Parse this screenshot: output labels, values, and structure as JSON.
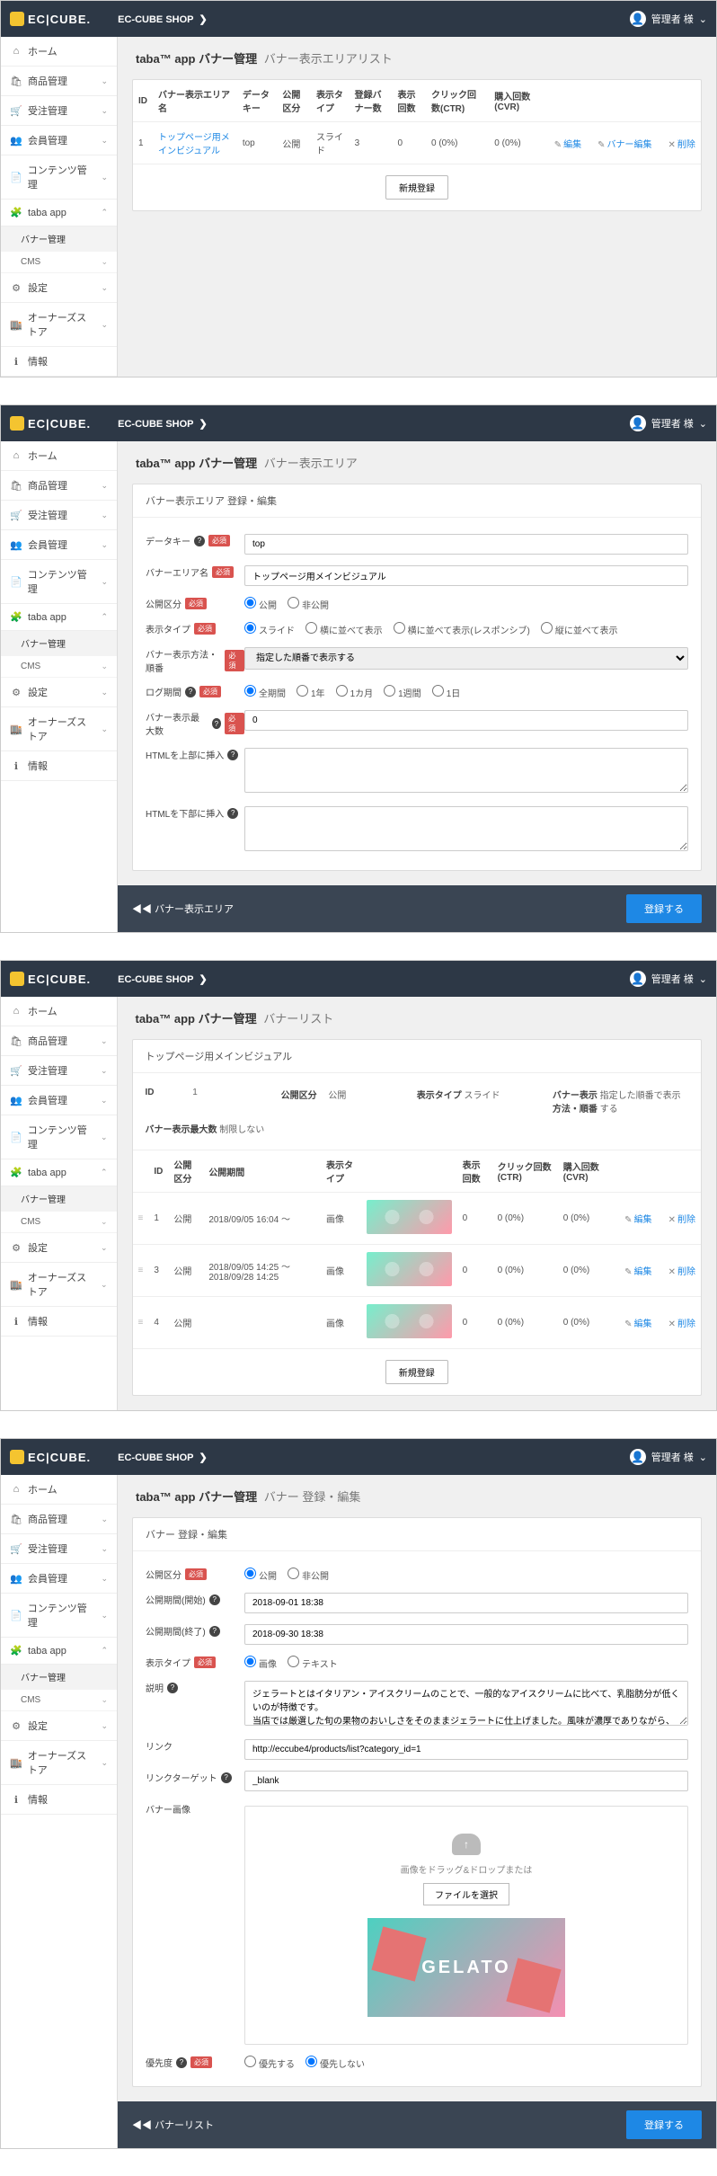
{
  "common": {
    "logo": "EC|CUBE.",
    "shop": "EC-CUBE SHOP",
    "user": "管理者 様",
    "chev": "❯",
    "down": "⌄"
  },
  "side": {
    "items": [
      {
        "ic": "⌂",
        "l": "ホーム",
        "e": ""
      },
      {
        "ic": "🛍",
        "l": "商品管理",
        "e": "⌄"
      },
      {
        "ic": "🛒",
        "l": "受注管理",
        "e": "⌄"
      },
      {
        "ic": "👥",
        "l": "会員管理",
        "e": "⌄"
      },
      {
        "ic": "📄",
        "l": "コンテンツ管理",
        "e": "⌄"
      },
      {
        "ic": "🧩",
        "l": "taba app",
        "e": "⌃"
      }
    ],
    "subs": [
      {
        "l": "バナー管理",
        "a": true
      },
      {
        "l": "CMS",
        "e": "⌄"
      }
    ],
    "items2": [
      {
        "ic": "⚙",
        "l": "設定",
        "e": "⌄"
      },
      {
        "ic": "🏬",
        "l": "オーナーズストア",
        "e": "⌄"
      },
      {
        "ic": "ℹ",
        "l": "情報",
        "e": ""
      }
    ]
  },
  "s1": {
    "title": "taba™ app バナー管理",
    "sub": "バナー表示エリアリスト",
    "th": [
      "ID",
      "バナー表示エリア名",
      "データキー",
      "公開区分",
      "表示タイプ",
      "登録バナー数",
      "表示回数",
      "クリック回数(CTR)",
      "購入回数(CVR)",
      "",
      "",
      ""
    ],
    "row": {
      "id": "1",
      "name": "トップページ用メインビジュアル",
      "key": "top",
      "pub": "公開",
      "type": "スライド",
      "cnt": "3",
      "imp": "0",
      "ctr": "0 (0%)",
      "cvr": "0 (0%)",
      "e": "編集",
      "b": "バナー編集",
      "d": "削除"
    },
    "new": "新規登録"
  },
  "s2": {
    "title": "taba™ app バナー管理",
    "sub": "バナー表示エリア",
    "hd": "バナー表示エリア 登録・編集",
    "f": {
      "key": {
        "l": "データキー",
        "v": "top"
      },
      "name": {
        "l": "バナーエリア名",
        "v": "トップページ用メインビジュアル"
      },
      "pub": {
        "l": "公開区分",
        "o": [
          "公開",
          "非公開"
        ]
      },
      "dtype": {
        "l": "表示タイプ",
        "o": [
          "スライド",
          "横に並べて表示",
          "横に並べて表示(レスポンシブ)",
          "縦に並べて表示"
        ]
      },
      "order": {
        "l": "バナー表示方法・順番",
        "v": "指定した順番で表示する"
      },
      "log": {
        "l": "ログ期間",
        "o": [
          "全期間",
          "1年",
          "1カ月",
          "1週間",
          "1日"
        ]
      },
      "max": {
        "l": "バナー表示最大数",
        "v": "0"
      },
      "htop": {
        "l": "HTMLを上部に挿入"
      },
      "hbot": {
        "l": "HTMLを下部に挿入"
      }
    },
    "back": "バナー表示エリア",
    "save": "登録する"
  },
  "s3": {
    "title": "taba™ app バナー管理",
    "sub": "バナーリスト",
    "area": "トップページ用メインビジュアル",
    "info": [
      [
        "ID",
        "1",
        "公開区分",
        "公開",
        "表示タイプ",
        "スライド",
        "バナー表示方法・順番",
        "指定した順番で表示する"
      ],
      [
        "バナー表示最大数",
        "制限しない"
      ]
    ],
    "th": [
      "",
      "ID",
      "公開区分",
      "公開期間",
      "表示タイプ",
      "",
      "表示回数",
      "クリック回数(CTR)",
      "購入回数(CVR)",
      "",
      ""
    ],
    "rows": [
      {
        "id": "1",
        "pub": "公開",
        "pd": "2018/09/05 16:04 ～",
        "tp": "画像",
        "imp": "0",
        "ctr": "0 (0%)",
        "cvr": "0 (0%)"
      },
      {
        "id": "3",
        "pub": "公開",
        "pd": "2018/09/05 14:25 ～ 2018/09/28 14:25",
        "tp": "画像",
        "imp": "0",
        "ctr": "0 (0%)",
        "cvr": "0 (0%)"
      },
      {
        "id": "4",
        "pub": "公開",
        "pd": "",
        "tp": "画像",
        "imp": "0",
        "ctr": "0 (0%)",
        "cvr": "0 (0%)"
      }
    ],
    "edit": "編集",
    "del": "削除",
    "new": "新規登録"
  },
  "s4": {
    "title": "taba™ app バナー管理",
    "sub": "バナー 登録・編集",
    "hd": "バナー 登録・編集",
    "f": {
      "pub": {
        "l": "公開区分",
        "o": [
          "公開",
          "非公開"
        ]
      },
      "ps": {
        "l": "公開期間(開始)",
        "v": "2018-09-01 18:38"
      },
      "pe": {
        "l": "公開期間(終了)",
        "v": "2018-09-30 18:38"
      },
      "dtype": {
        "l": "表示タイプ",
        "o": [
          "画像",
          "テキスト"
        ]
      },
      "desc": {
        "l": "説明",
        "v": "ジェラートとはイタリアン・アイスクリームのことで、一般的なアイスクリームに比べて、乳脂肪分が低くいのが特徴です。\n当店では厳選した旬の果物のおいしさをそのままジェラートに仕上げました。風味が濃厚でありながら、甘さ控えめでヘルシーなキューブジ"
      },
      "link": {
        "l": "リンク",
        "v": "http://eccube4/products/list?category_id=1"
      },
      "tgt": {
        "l": "リンクターゲット",
        "v": "_blank"
      },
      "img": {
        "l": "バナー画像",
        "drop": "画像をドラッグ&ドロップまたは",
        "btn": "ファイルを選択",
        "txt": "GELATO"
      },
      "pri": {
        "l": "優先度",
        "o": [
          "優先する",
          "優先しない"
        ]
      }
    },
    "back": "バナーリスト",
    "save": "登録する"
  }
}
